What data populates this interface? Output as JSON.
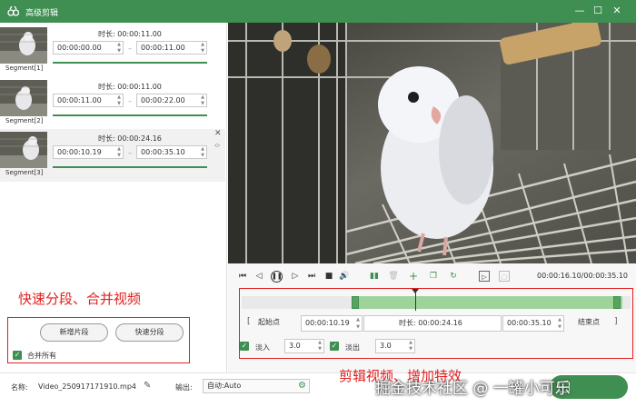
{
  "window": {
    "title": "高级剪辑",
    "minimize": "—",
    "maximize": "☐",
    "close": "✕"
  },
  "segments": [
    {
      "label": "Segment[1]",
      "duration": "时长: 00:00:11.00",
      "start": "00:00:00.00",
      "end": "00:00:11.00",
      "active": false
    },
    {
      "label": "Segment[2]",
      "duration": "时长: 00:00:11.00",
      "start": "00:00:11.00",
      "end": "00:00:22.00",
      "active": false
    },
    {
      "label": "Segment[3]",
      "duration": "时长: 00:00:24.16",
      "start": "00:00:10.19",
      "end": "00:00:35.10",
      "active": true
    }
  ],
  "left_panel": {
    "annotation": "快速分段、合并视频",
    "add_segment": "新增片段",
    "quick_split": "快速分段",
    "merge_all": "合并所有",
    "merge_all_checked": true
  },
  "player": {
    "time": "00:00:16.10/00:00:35.10"
  },
  "editor": {
    "start_point": "起始点",
    "start_time": "00:00:10.19",
    "duration": "时长: 00:00:24.16",
    "end_time": "00:00:35.10",
    "end_point": "结束点",
    "fade_in_label": "淡入",
    "fade_in_value": "3.0",
    "fade_in_checked": true,
    "fade_out_label": "淡出",
    "fade_out_value": "3.0",
    "fade_out_checked": true,
    "annotation": "剪辑视频、增加特效"
  },
  "bottom": {
    "name_label": "名称:",
    "name_value": "Video_250917171910.mp4",
    "output_label": "输出:",
    "output_value": "自动:Auto"
  },
  "watermark": "掘金技术社区 @ 一罐小可乐",
  "colors": {
    "accent": "#3f8f52",
    "annotation_red": "#e02020",
    "timeline_range": "#9fd39c"
  }
}
